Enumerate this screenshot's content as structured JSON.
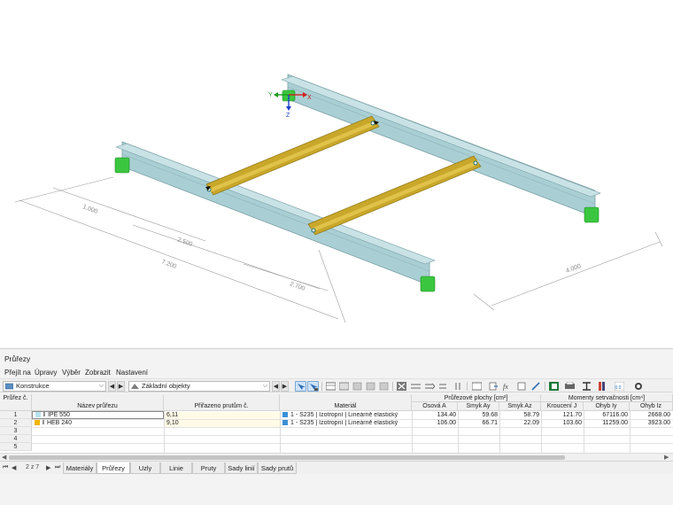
{
  "viewport": {
    "axes": {
      "x": "X",
      "y": "Y",
      "z": "Z"
    },
    "dimensions": [
      "1.000",
      "2.500",
      "7.200",
      "2.700",
      "4.000"
    ]
  },
  "panel": {
    "title": "Průřezy",
    "menu": [
      "Přejít na",
      "Úpravy",
      "Výběr",
      "Zobrazit",
      "Nastavení"
    ]
  },
  "toolbar": {
    "combo_left": "Konstrukce",
    "combo_right": "Základní objekty"
  },
  "table": {
    "group_headers": {
      "areas": "Průřezové plochy [cm²]",
      "moments": "Momenty setrvačnosti [cm⁴]"
    },
    "headers": {
      "num": "Průřez č.",
      "name": "Název průřezu",
      "assigned": "Přiřazeno prutům č.",
      "material": "Materiál",
      "area": "Osová A",
      "shear_y": "Smyk Ay",
      "shear_z": "Smyk Az",
      "torsion": "Kroucení J",
      "bend_y": "Ohyb Iy",
      "bend_z": "Ohyb Iz"
    },
    "rows": [
      {
        "no": "1",
        "name": "IPE 550",
        "color": "#b7e3ef",
        "assigned": "6,11",
        "material": "1 - S235 | Izotropní | Lineárně elastický",
        "A": "134.40",
        "Ay": "59.68",
        "Az": "58.79",
        "J": "121.70",
        "Iy": "67116.00",
        "Iz": "2668.00"
      },
      {
        "no": "2",
        "name": "HEB 240",
        "color": "#f0b400",
        "assigned": "9,10",
        "material": "1 - S235 | Izotropní | Lineárně elastický",
        "A": "106.00",
        "Ay": "66.71",
        "Az": "22.09",
        "J": "103.60",
        "Iy": "11259.00",
        "Iz": "3923.00"
      }
    ],
    "empty_rows": [
      "3",
      "4",
      "5"
    ],
    "material_color": "#3b8fd6"
  },
  "tabs": {
    "page_indicator": "2 z 7",
    "items": [
      "Materiály",
      "Průřezy",
      "Uzly",
      "Linie",
      "Pruty",
      "Sady linií",
      "Sady prutů"
    ],
    "active": "Průřezy"
  }
}
